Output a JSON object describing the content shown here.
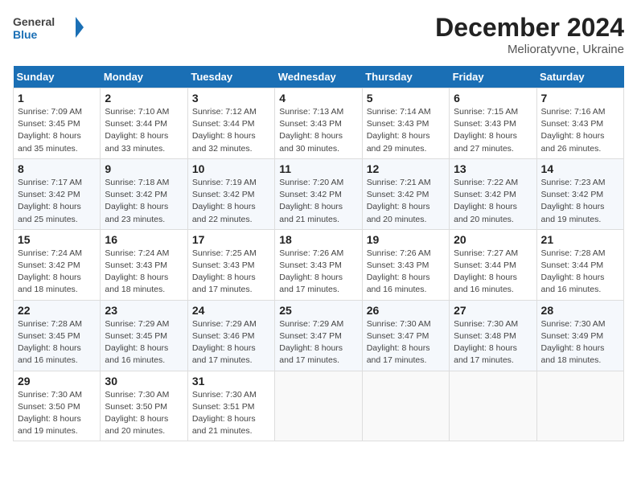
{
  "header": {
    "logo_line1": "General",
    "logo_line2": "Blue",
    "month": "December 2024",
    "location": "Melioratyvne, Ukraine"
  },
  "days_of_week": [
    "Sunday",
    "Monday",
    "Tuesday",
    "Wednesday",
    "Thursday",
    "Friday",
    "Saturday"
  ],
  "weeks": [
    [
      {
        "day": "1",
        "sunrise": "Sunrise: 7:09 AM",
        "sunset": "Sunset: 3:45 PM",
        "daylight": "Daylight: 8 hours and 35 minutes."
      },
      {
        "day": "2",
        "sunrise": "Sunrise: 7:10 AM",
        "sunset": "Sunset: 3:44 PM",
        "daylight": "Daylight: 8 hours and 33 minutes."
      },
      {
        "day": "3",
        "sunrise": "Sunrise: 7:12 AM",
        "sunset": "Sunset: 3:44 PM",
        "daylight": "Daylight: 8 hours and 32 minutes."
      },
      {
        "day": "4",
        "sunrise": "Sunrise: 7:13 AM",
        "sunset": "Sunset: 3:43 PM",
        "daylight": "Daylight: 8 hours and 30 minutes."
      },
      {
        "day": "5",
        "sunrise": "Sunrise: 7:14 AM",
        "sunset": "Sunset: 3:43 PM",
        "daylight": "Daylight: 8 hours and 29 minutes."
      },
      {
        "day": "6",
        "sunrise": "Sunrise: 7:15 AM",
        "sunset": "Sunset: 3:43 PM",
        "daylight": "Daylight: 8 hours and 27 minutes."
      },
      {
        "day": "7",
        "sunrise": "Sunrise: 7:16 AM",
        "sunset": "Sunset: 3:43 PM",
        "daylight": "Daylight: 8 hours and 26 minutes."
      }
    ],
    [
      {
        "day": "8",
        "sunrise": "Sunrise: 7:17 AM",
        "sunset": "Sunset: 3:42 PM",
        "daylight": "Daylight: 8 hours and 25 minutes."
      },
      {
        "day": "9",
        "sunrise": "Sunrise: 7:18 AM",
        "sunset": "Sunset: 3:42 PM",
        "daylight": "Daylight: 8 hours and 23 minutes."
      },
      {
        "day": "10",
        "sunrise": "Sunrise: 7:19 AM",
        "sunset": "Sunset: 3:42 PM",
        "daylight": "Daylight: 8 hours and 22 minutes."
      },
      {
        "day": "11",
        "sunrise": "Sunrise: 7:20 AM",
        "sunset": "Sunset: 3:42 PM",
        "daylight": "Daylight: 8 hours and 21 minutes."
      },
      {
        "day": "12",
        "sunrise": "Sunrise: 7:21 AM",
        "sunset": "Sunset: 3:42 PM",
        "daylight": "Daylight: 8 hours and 20 minutes."
      },
      {
        "day": "13",
        "sunrise": "Sunrise: 7:22 AM",
        "sunset": "Sunset: 3:42 PM",
        "daylight": "Daylight: 8 hours and 20 minutes."
      },
      {
        "day": "14",
        "sunrise": "Sunrise: 7:23 AM",
        "sunset": "Sunset: 3:42 PM",
        "daylight": "Daylight: 8 hours and 19 minutes."
      }
    ],
    [
      {
        "day": "15",
        "sunrise": "Sunrise: 7:24 AM",
        "sunset": "Sunset: 3:42 PM",
        "daylight": "Daylight: 8 hours and 18 minutes."
      },
      {
        "day": "16",
        "sunrise": "Sunrise: 7:24 AM",
        "sunset": "Sunset: 3:43 PM",
        "daylight": "Daylight: 8 hours and 18 minutes."
      },
      {
        "day": "17",
        "sunrise": "Sunrise: 7:25 AM",
        "sunset": "Sunset: 3:43 PM",
        "daylight": "Daylight: 8 hours and 17 minutes."
      },
      {
        "day": "18",
        "sunrise": "Sunrise: 7:26 AM",
        "sunset": "Sunset: 3:43 PM",
        "daylight": "Daylight: 8 hours and 17 minutes."
      },
      {
        "day": "19",
        "sunrise": "Sunrise: 7:26 AM",
        "sunset": "Sunset: 3:43 PM",
        "daylight": "Daylight: 8 hours and 16 minutes."
      },
      {
        "day": "20",
        "sunrise": "Sunrise: 7:27 AM",
        "sunset": "Sunset: 3:44 PM",
        "daylight": "Daylight: 8 hours and 16 minutes."
      },
      {
        "day": "21",
        "sunrise": "Sunrise: 7:28 AM",
        "sunset": "Sunset: 3:44 PM",
        "daylight": "Daylight: 8 hours and 16 minutes."
      }
    ],
    [
      {
        "day": "22",
        "sunrise": "Sunrise: 7:28 AM",
        "sunset": "Sunset: 3:45 PM",
        "daylight": "Daylight: 8 hours and 16 minutes."
      },
      {
        "day": "23",
        "sunrise": "Sunrise: 7:29 AM",
        "sunset": "Sunset: 3:45 PM",
        "daylight": "Daylight: 8 hours and 16 minutes."
      },
      {
        "day": "24",
        "sunrise": "Sunrise: 7:29 AM",
        "sunset": "Sunset: 3:46 PM",
        "daylight": "Daylight: 8 hours and 17 minutes."
      },
      {
        "day": "25",
        "sunrise": "Sunrise: 7:29 AM",
        "sunset": "Sunset: 3:47 PM",
        "daylight": "Daylight: 8 hours and 17 minutes."
      },
      {
        "day": "26",
        "sunrise": "Sunrise: 7:30 AM",
        "sunset": "Sunset: 3:47 PM",
        "daylight": "Daylight: 8 hours and 17 minutes."
      },
      {
        "day": "27",
        "sunrise": "Sunrise: 7:30 AM",
        "sunset": "Sunset: 3:48 PM",
        "daylight": "Daylight: 8 hours and 17 minutes."
      },
      {
        "day": "28",
        "sunrise": "Sunrise: 7:30 AM",
        "sunset": "Sunset: 3:49 PM",
        "daylight": "Daylight: 8 hours and 18 minutes."
      }
    ],
    [
      {
        "day": "29",
        "sunrise": "Sunrise: 7:30 AM",
        "sunset": "Sunset: 3:50 PM",
        "daylight": "Daylight: 8 hours and 19 minutes."
      },
      {
        "day": "30",
        "sunrise": "Sunrise: 7:30 AM",
        "sunset": "Sunset: 3:50 PM",
        "daylight": "Daylight: 8 hours and 20 minutes."
      },
      {
        "day": "31",
        "sunrise": "Sunrise: 7:30 AM",
        "sunset": "Sunset: 3:51 PM",
        "daylight": "Daylight: 8 hours and 21 minutes."
      },
      null,
      null,
      null,
      null
    ]
  ]
}
